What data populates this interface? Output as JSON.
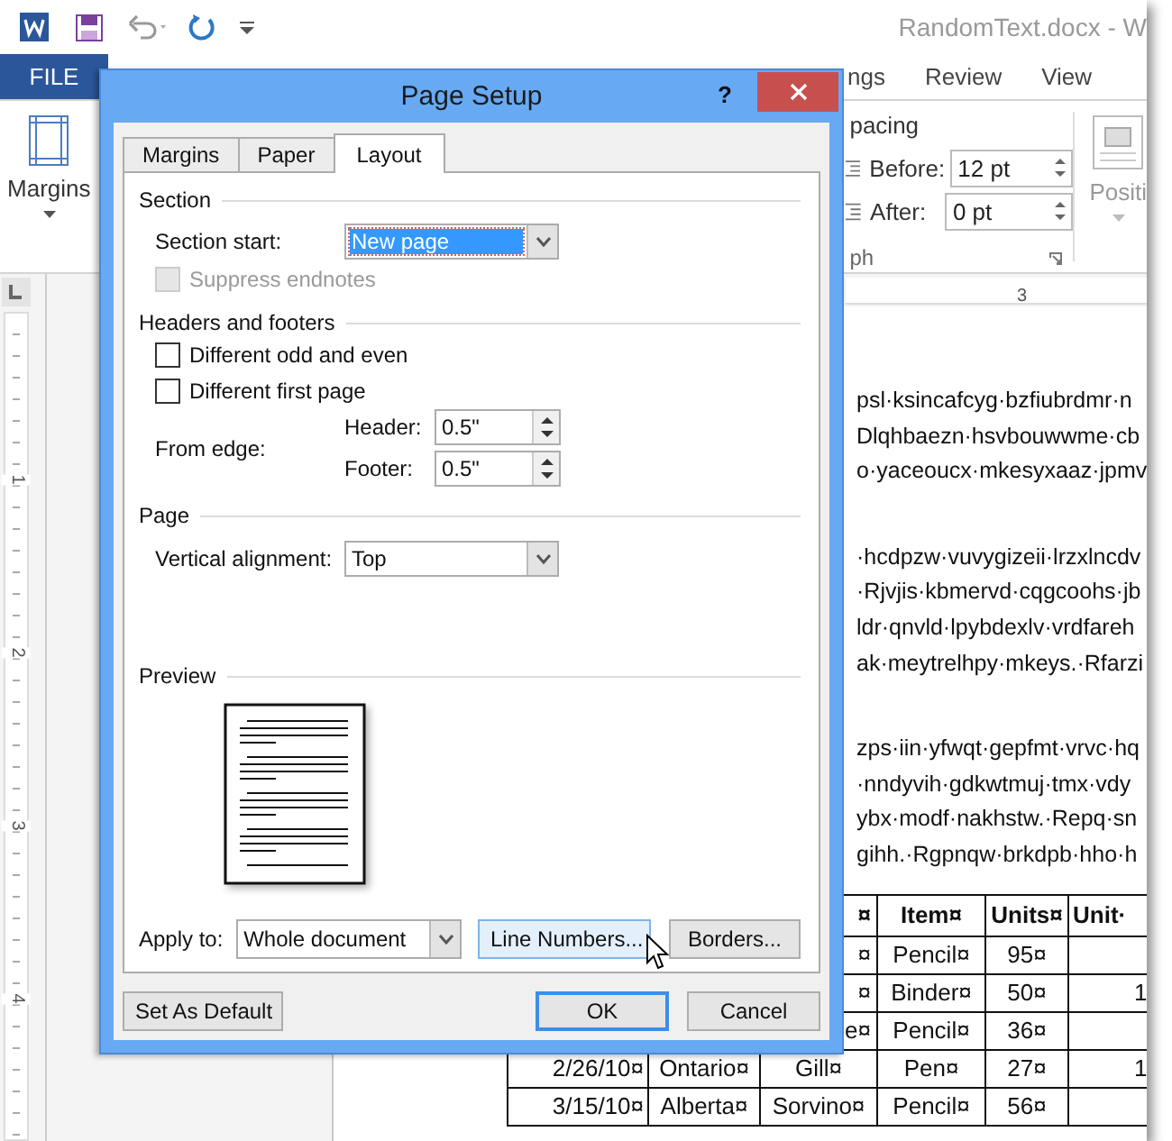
{
  "title_bar": {
    "document_title": "RandomText.docx - W"
  },
  "ribbon_tabs": [
    {
      "label": "FILE",
      "kind": "file"
    },
    {
      "label": "ngs",
      "kind": "tab"
    },
    {
      "label": "Review",
      "kind": "tab"
    },
    {
      "label": "View",
      "kind": "tab"
    }
  ],
  "ribbon": {
    "margins_button": "Margins",
    "spacing": {
      "title": "pacing",
      "before_label": "Before:",
      "before_value": "12 pt",
      "after_label": "After:",
      "after_value": "0 pt",
      "group_label": "ph"
    },
    "position_button": "Positi"
  },
  "horizontal_ruler": {
    "label": "3"
  },
  "vertical_ruler": {
    "labels": [
      "1",
      "2",
      "3",
      "4"
    ]
  },
  "document": {
    "paragraphs": [
      [
        "psl·ksincafcyg·bzfiubrdmr·n",
        "Dlqhbaezn·hsvbouwwme·cb",
        "o·yaceoucx·mkesyxaaz·jpmv"
      ],
      [
        "·hcdpzw·vuvygizeii·lrzxlncdv",
        "·Rjvjis·kbmervd·cqgcoohs·jb",
        "ldr·qnvld·lpybdexlv·vrdfareh",
        "ak·meytrelhpy·mkeys.·Rfarzi"
      ],
      [
        "zps·iin·yfwqt·gepfmt·vrvc·hq",
        "·nndyvih·gdkwtmuj·tmx·vdy",
        "ybx·modf·nakhstw.·Repq·sn",
        "gihh.·Rgpnqw·brkdpb·hho·h"
      ]
    ],
    "table": {
      "rows": [
        {
          "header": true,
          "covered": true,
          "cells": [
            "",
            "",
            "¤",
            "Item¤",
            "Units¤",
            "Unit·"
          ]
        },
        {
          "header": false,
          "covered": true,
          "cells": [
            "",
            "",
            "¤",
            "Pencil¤",
            "95¤",
            ""
          ]
        },
        {
          "header": false,
          "covered": true,
          "cells": [
            "",
            "",
            "¤",
            "Binder¤",
            "50¤",
            "1"
          ]
        },
        {
          "header": false,
          "covered": true,
          "cells": [
            "",
            "",
            "e¤",
            "Pencil¤",
            "36¤",
            ""
          ]
        },
        {
          "header": false,
          "covered": false,
          "cells": [
            "2/26/10¤",
            "Ontario¤",
            "Gill¤",
            "Pen¤",
            "27¤",
            "1"
          ]
        },
        {
          "header": false,
          "covered": false,
          "cells": [
            "3/15/10¤",
            "Alberta¤",
            "Sorvino¤",
            "Pencil¤",
            "56¤",
            ""
          ]
        }
      ]
    }
  },
  "dialog": {
    "title": "Page Setup",
    "help": "?",
    "tabs": [
      {
        "label": "Margins",
        "selected": false
      },
      {
        "label": "Paper",
        "selected": false
      },
      {
        "label": "Layout",
        "selected": true
      }
    ],
    "section": {
      "heading": "Section",
      "section_start_label": "Section start:",
      "section_start_value": "New page",
      "suppress_endnotes": {
        "label": "Suppress endnotes",
        "checked": false,
        "disabled": true
      }
    },
    "headers_footers": {
      "heading": "Headers and footers",
      "checkboxes": [
        {
          "label": "Different odd and even",
          "checked": false,
          "disabled": false
        },
        {
          "label": "Different first page",
          "checked": false,
          "disabled": false
        }
      ],
      "from_edge_label": "From edge:",
      "header_label": "Header:",
      "header_value": "0.5\"",
      "footer_label": "Footer:",
      "footer_value": "0.5\""
    },
    "page": {
      "heading": "Page",
      "vertical_alignment_label": "Vertical alignment:",
      "vertical_alignment_value": "Top"
    },
    "preview": {
      "heading": "Preview"
    },
    "apply_to_label": "Apply to:",
    "apply_to_value": "Whole document",
    "apply_buttons": [
      {
        "label": "Line Numbers...",
        "hovered": true
      },
      {
        "label": "Borders...",
        "hovered": false
      }
    ],
    "set_default_button": "Set As Default",
    "buttons": [
      {
        "label": "OK",
        "default": true
      },
      {
        "label": "Cancel",
        "default": false
      }
    ]
  }
}
